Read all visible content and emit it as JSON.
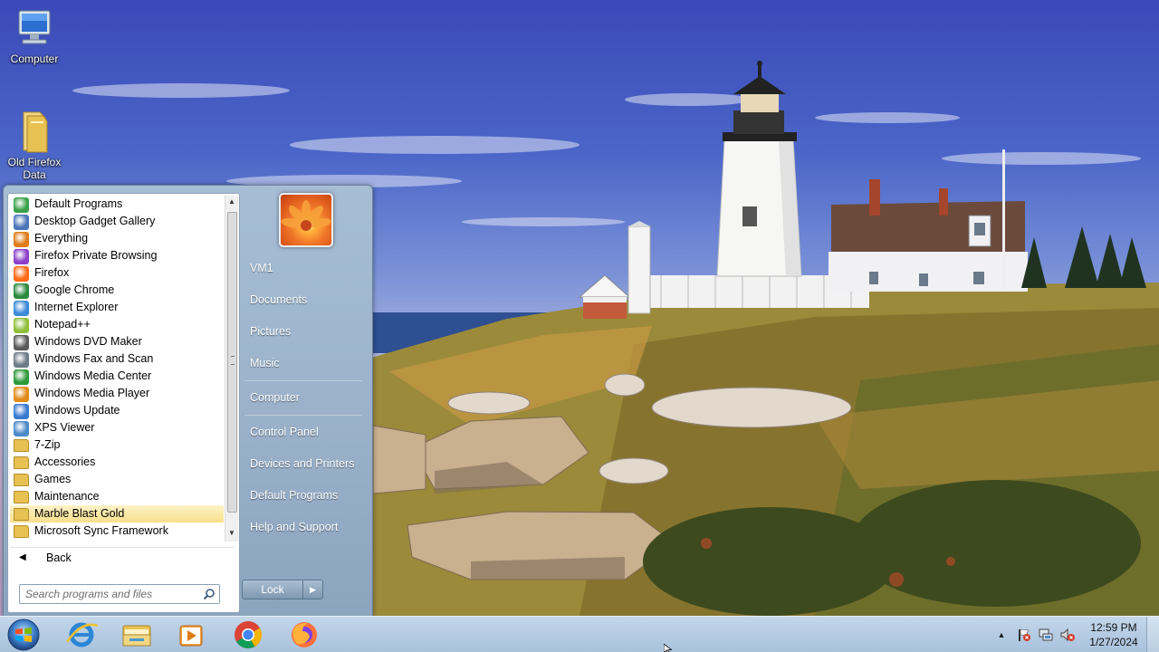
{
  "desktop": {
    "icons": [
      {
        "label": "Computer",
        "icon": "computer-icon"
      },
      {
        "label": "Old Firefox Data",
        "icon": "folder-icon"
      }
    ]
  },
  "start_menu": {
    "programs": [
      {
        "label": "Default Programs",
        "icon": "default-programs-icon",
        "color": "#3aa14a"
      },
      {
        "label": "Desktop Gadget Gallery",
        "icon": "gadget-icon",
        "color": "#4a76b8"
      },
      {
        "label": "Everything",
        "icon": "magnifier-icon",
        "color": "#e07a18"
      },
      {
        "label": "Firefox Private Browsing",
        "icon": "private-browsing-icon",
        "color": "#8b3fc9"
      },
      {
        "label": "Firefox",
        "icon": "firefox-icon",
        "color": "#ff6a16"
      },
      {
        "label": "Google Chrome",
        "icon": "chrome-icon",
        "color": "#2c8a3e"
      },
      {
        "label": "Internet Explorer",
        "icon": "ie-icon",
        "color": "#3b8ad8"
      },
      {
        "label": "Notepad++",
        "icon": "notepadpp-icon",
        "color": "#8fbf3a"
      },
      {
        "label": "Windows DVD Maker",
        "icon": "dvd-maker-icon",
        "color": "#5a5a5a"
      },
      {
        "label": "Windows Fax and Scan",
        "icon": "fax-icon",
        "color": "#6d7a88"
      },
      {
        "label": "Windows Media Center",
        "icon": "media-center-icon",
        "color": "#2e9a3a"
      },
      {
        "label": "Windows Media Player",
        "icon": "media-player-icon",
        "color": "#e08a18"
      },
      {
        "label": "Windows Update",
        "icon": "windows-update-icon",
        "color": "#3a7ad0"
      },
      {
        "label": "XPS Viewer",
        "icon": "xps-viewer-icon",
        "color": "#4a8ac8"
      },
      {
        "label": "7-Zip",
        "icon": "folder-icon",
        "folder": true
      },
      {
        "label": "Accessories",
        "icon": "folder-icon",
        "folder": true
      },
      {
        "label": "Games",
        "icon": "folder-icon",
        "folder": true
      },
      {
        "label": "Maintenance",
        "icon": "folder-icon",
        "folder": true
      },
      {
        "label": "Marble Blast Gold",
        "icon": "folder-icon",
        "folder": true,
        "selected": true
      },
      {
        "label": "Microsoft Sync Framework",
        "icon": "folder-icon",
        "folder": true
      }
    ],
    "back_label": "Back",
    "search_placeholder": "Search programs and files",
    "right_links": [
      {
        "label": "VM1"
      },
      {
        "label": "Documents"
      },
      {
        "label": "Pictures"
      },
      {
        "label": "Music"
      },
      {
        "label": "Computer"
      },
      {
        "label": "Control Panel"
      },
      {
        "label": "Devices and Printers"
      },
      {
        "label": "Default Programs"
      },
      {
        "label": "Help and Support"
      }
    ],
    "lock_label": "Lock"
  },
  "taskbar": {
    "pinned": [
      {
        "name": "internet-explorer",
        "icon": "ie-icon"
      },
      {
        "name": "file-explorer",
        "icon": "file-explorer-icon"
      },
      {
        "name": "media-player",
        "icon": "media-player-icon"
      },
      {
        "name": "google-chrome",
        "icon": "chrome-icon"
      },
      {
        "name": "firefox",
        "icon": "firefox-icon"
      }
    ],
    "clock": {
      "time": "12:59 PM",
      "date": "1/27/2024"
    }
  }
}
